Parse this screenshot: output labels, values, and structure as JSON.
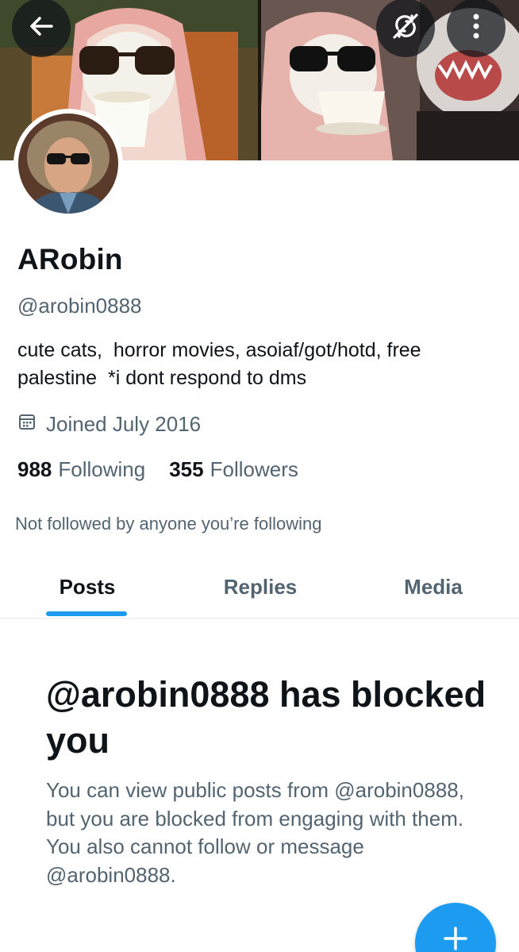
{
  "header": {
    "back_icon": "arrow-left-icon",
    "sync_icon": "sync-off-icon",
    "more_icon": "more-vertical-icon"
  },
  "profile": {
    "display_name": "ARobin",
    "handle": "@arobin0888",
    "bio": "cute cats,  horror movies, asoiaf/got/hotd, free palestine  *i dont respond to dms",
    "joined": "Joined July 2016",
    "joined_icon": "calendar-icon",
    "following_count": "988",
    "following_label": "Following",
    "followers_count": "355",
    "followers_label": "Followers",
    "not_followed": "Not followed by anyone you’re following"
  },
  "tabs": [
    {
      "label": "Posts",
      "active": true
    },
    {
      "label": "Replies",
      "active": false
    },
    {
      "label": "Media",
      "active": false
    }
  ],
  "blocked": {
    "title": "@arobin0888 has blocked you",
    "body": "You can view public posts from @arobin0888, but you are blocked from engaging with them. You also cannot follow or message @arobin0888."
  },
  "fab": {
    "icon": "plus-icon"
  },
  "colors": {
    "accent": "#1d9bf0",
    "text_primary": "#0f1419",
    "text_secondary": "#536471",
    "divider": "#e6e9eb"
  }
}
